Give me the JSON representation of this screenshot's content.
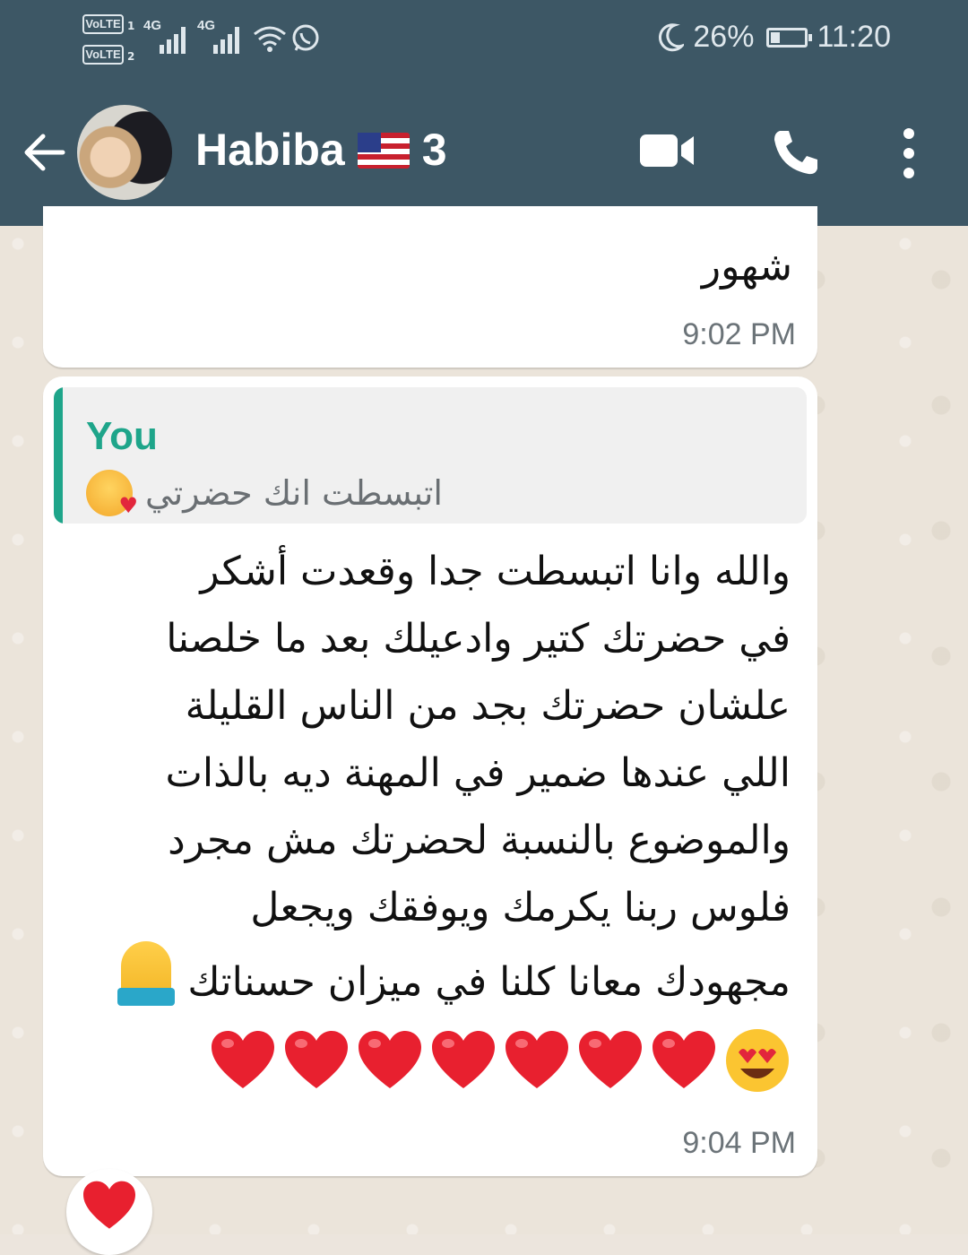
{
  "status_bar": {
    "sim1_label": "VoLTE",
    "sim1_number": "1",
    "sim2_label": "VoLTE",
    "sim2_number": "2",
    "network1": "4G",
    "network2": "4G",
    "battery_percent": "26%",
    "battery_level": 0.26,
    "time": "11:20",
    "icons": [
      "wifi-icon",
      "whatsapp-icon",
      "moon-icon",
      "battery-icon"
    ]
  },
  "header": {
    "contact_name": "Habiba",
    "contact_suffix": "3",
    "flag": "us-flag-icon",
    "colors": {
      "bar": "#3d5765",
      "accent": "#1ea58a"
    }
  },
  "messages": [
    {
      "text": "شهور",
      "time": "9:02 PM"
    },
    {
      "quoted_author": "You",
      "quoted_text": "اتبسطت انك حضرتي",
      "lines": [
        "والله وانا اتبسطت جدا وقعدت أشكر",
        "في حضرتك كتير وادعيلك بعد ما خلصنا",
        "علشان حضرتك بجد من الناس القليلة",
        "اللي عندها ضمير في المهنة ديه بالذات",
        "والموضوع بالنسبة لحضرتك مش مجرد",
        "فلوس ربنا يكرمك ويوفقك ويجعل",
        "مجهودك معانا كلنا في ميزان حسناتك"
      ],
      "heart_count": 7,
      "time": "9:04 PM",
      "reaction": "red-heart"
    }
  ]
}
